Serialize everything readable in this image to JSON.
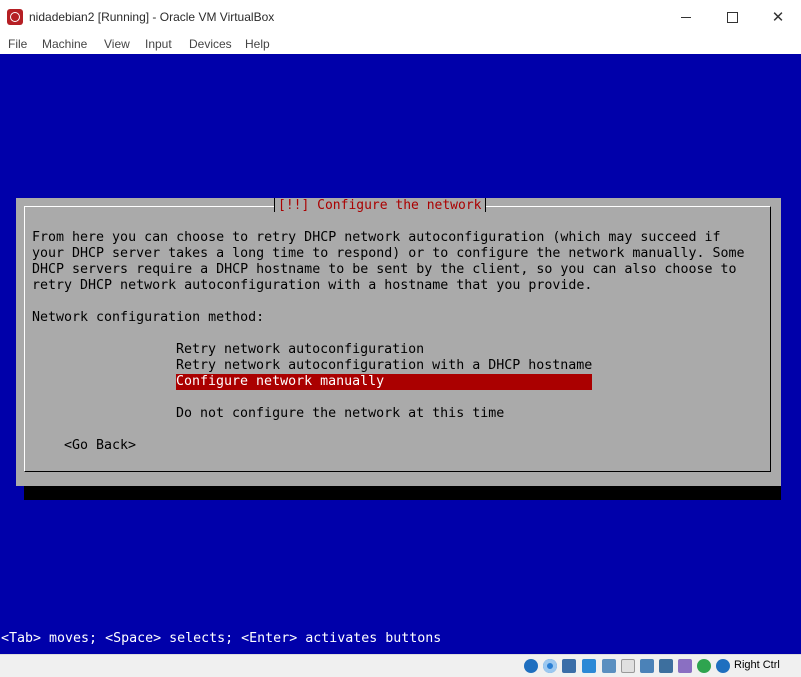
{
  "window": {
    "title": "nidadebian2 [Running] - Oracle VM VirtualBox",
    "close_glyph": "✕"
  },
  "menu": [
    "File",
    "Machine",
    "View",
    "Input",
    "Devices",
    "Help"
  ],
  "dialog": {
    "title": "[!!] Configure the network",
    "description": "From here you can choose to retry DHCP network autoconfiguration (which may succeed if\nyour DHCP server takes a long time to respond) or to configure the network manually. Some\nDHCP servers require a DHCP hostname to be sent by the client, so you can also choose to\nretry DHCP network autoconfiguration with a hostname that you provide.",
    "method_label": "Network configuration method:",
    "options": [
      "Retry network autoconfiguration",
      "Retry network autoconfiguration with a DHCP hostname",
      "Configure network manually",
      "Do not configure the network at this time"
    ],
    "selected_option": "Configure network manually",
    "go_back": "<Go Back>"
  },
  "hint": "<Tab> moves; <Space> selects; <Enter> activates buttons",
  "statusbar": {
    "host_key": "Right Ctrl",
    "icons": [
      "hard-disk-icon",
      "optical-drive-icon",
      "audio-icon",
      "network-icon",
      "usb-icon",
      "shared-folders-icon",
      "display-icon",
      "video-capture-icon",
      "cpu-icon",
      "mouse-integration-icon",
      "keyboard-icon"
    ]
  },
  "colors": {
    "screen_bg": "#0000aa",
    "dialog_bg": "#aaaaaa",
    "title_red": "#aa0000",
    "highlight": "#aa0000"
  }
}
